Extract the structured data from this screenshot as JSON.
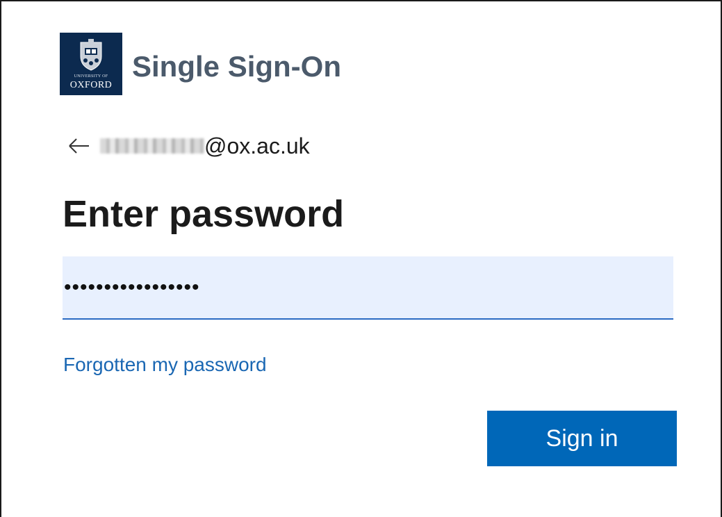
{
  "logo": {
    "line1": "UNIVERSITY OF",
    "line2": "OXFORD",
    "icon": "oxford-crest-icon",
    "background_color": "#0c2a4f"
  },
  "brand": {
    "title": "Single Sign-On",
    "color": "#4b5a6b"
  },
  "identity": {
    "back_icon": "back-arrow-icon",
    "email_domain": "@ox.ac.uk"
  },
  "heading": "Enter password",
  "password_field": {
    "value": "•••••••••••••••••",
    "input_type": "password",
    "background_color": "#e8f0fe",
    "underline_color": "#2a6ac3"
  },
  "forgot_link": {
    "label": "Forgotten my password",
    "color": "#1a67b3"
  },
  "sign_in_button": {
    "label": "Sign in",
    "background_color": "#0067b8"
  }
}
